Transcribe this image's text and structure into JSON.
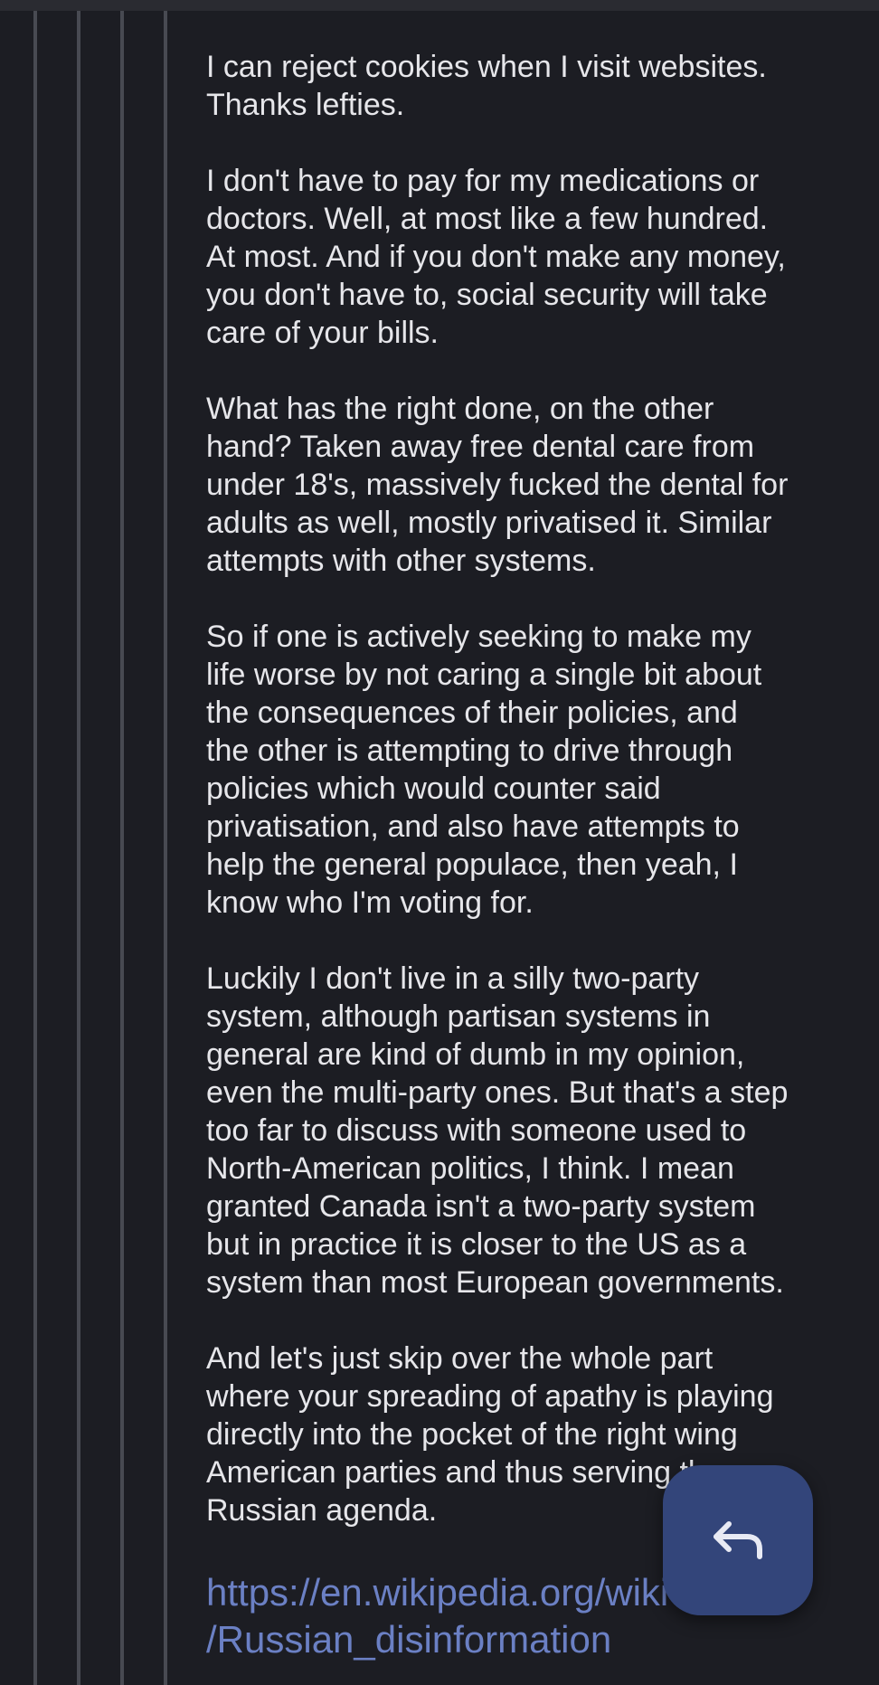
{
  "comment": {
    "paragraphs": [
      "I can reject cookies when I visit websites.\nThanks lefties.",
      "I don't have to pay for my medications or\ndoctors. Well, at most like a few hundred.\nAt most. And if you don't make any money,\nyou don't have to, social security will take\ncare of your bills.",
      "What has the right done, on the other\nhand? Taken away free dental care from\nunder 18's, massively fucked the dental for\nadults as well, mostly privatised it. Similar\nattempts with other systems.",
      "So if one is actively seeking to make my\nlife worse by not caring a single bit about\nthe consequences of their policies, and\nthe other is attempting to drive through\npolicies which would counter said\nprivatisation, and also have attempts to\nhelp the general populace, then yeah, I\nknow who I'm voting for.",
      "Luckily I don't live in a silly two-party\nsystem, although partisan systems in\ngeneral are kind of dumb in my opinion,\neven the multi-party ones. But that's a step\ntoo far to discuss with someone used to\nNorth-American politics, I think. I mean\ngranted Canada isn't a two-party system\nbut in practice it is closer to the US as a\nsystem than most European governments.",
      "And let's just skip over the whole part\nwhere your spreading of apathy is playing\ndirectly into the pocket of the right wing\nAmerican parties and thus serving the\nRussian agenda."
    ],
    "link_text": "https://en.wikipedia.org/wiki\n/Russian_disinformation"
  },
  "reply_button": {
    "icon": "reply-arrow-icon"
  },
  "colors": {
    "background": "#1c1d23",
    "text": "#e6e6ea",
    "link": "#6b80c4",
    "fab": "#33457a",
    "thread_line": "#484a52"
  }
}
